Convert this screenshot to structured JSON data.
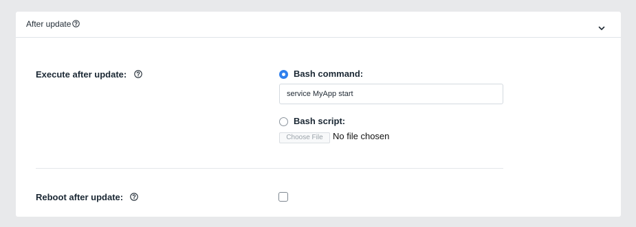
{
  "panel": {
    "title": "After update",
    "collapse_icon": "chevron-down-icon"
  },
  "execute": {
    "label": "Execute after update:",
    "help_icon": "question-circle-icon",
    "options": [
      {
        "label": "Bash command:",
        "selected": true
      },
      {
        "label": "Bash script:",
        "selected": false
      }
    ],
    "command_value": "service MyApp start",
    "file_button_label": "Choose File",
    "file_status": "No file chosen"
  },
  "reboot": {
    "label": "Reboot after update:",
    "checked": false
  },
  "colors": {
    "accent": "#2f80ed",
    "background": "#e8e9eb",
    "panel": "#ffffff"
  }
}
